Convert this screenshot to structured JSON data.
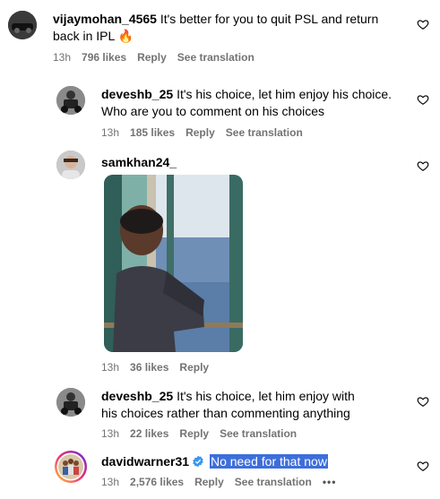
{
  "comments": [
    {
      "username": "vijaymohan_4565",
      "text": "It's better for you to quit PSL and return back in IPL",
      "emoji": "🔥",
      "time": "13h",
      "likes": "796 likes",
      "reply": "Reply",
      "translate": "See translation"
    },
    {
      "username": "deveshb_25",
      "text": "It's his choice, let him enjoy his choice. Who are you to comment on his choices",
      "time": "13h",
      "likes": "185 likes",
      "reply": "Reply",
      "translate": "See translation"
    },
    {
      "username": "samkhan24_",
      "time": "13h",
      "likes": "36 likes",
      "reply": "Reply"
    },
    {
      "username": "deveshb_25",
      "text": "It's his choice, let him enjoy with his choices rather than commenting anything",
      "time": "13h",
      "likes": "22 likes",
      "reply": "Reply",
      "translate": "See translation"
    },
    {
      "username": "davidwarner31",
      "text": "No need for that now",
      "time": "13h",
      "likes": "2,576 likes",
      "reply": "Reply",
      "translate": "See translation",
      "more": "•••"
    }
  ],
  "icons": {
    "like": "heart-outline-icon",
    "verified": "verified-badge-icon",
    "more": "more-options-icon"
  },
  "colors": {
    "meta_text": "#737373",
    "selection_highlight": "#3d6edb",
    "verified_blue": "#3897f0"
  }
}
